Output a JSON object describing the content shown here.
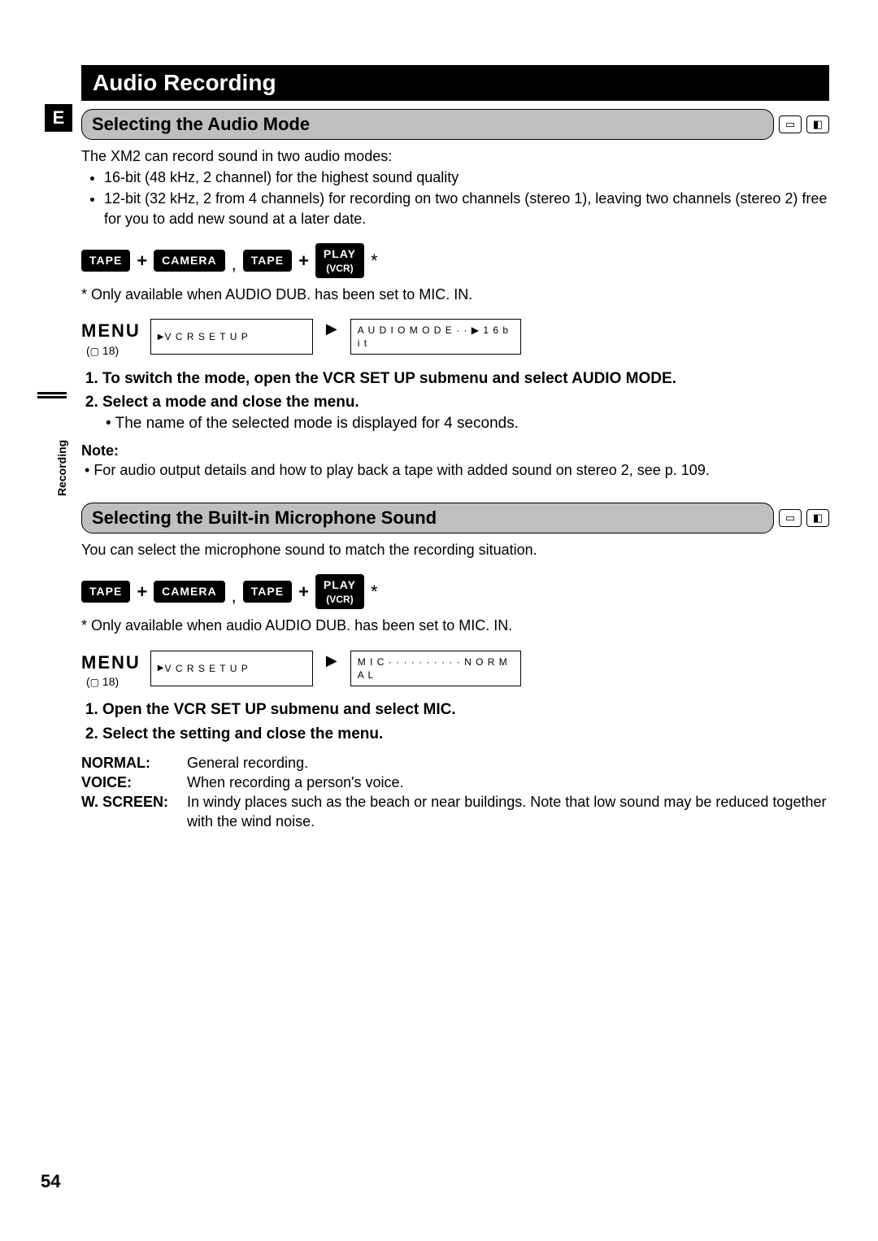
{
  "language_badge": "E",
  "side_tab": "Recording",
  "page_number": "54",
  "title": "Audio Recording",
  "section1": {
    "heading": "Selecting the Audio Mode",
    "intro": "The XM2 can record sound in two audio modes:",
    "bullets": [
      "16-bit (48 kHz, 2 channel) for the highest sound quality",
      "12-bit (32 kHz, 2 from 4 channels) for recording on two channels (stereo 1), leaving two channels (stereo 2) free for you to add new sound at a later date."
    ],
    "footnote": "* Only available when AUDIO DUB. has been set to MIC. IN.",
    "menu_label": "MENU",
    "menu_ref": "18",
    "osd1_label": "V C R   S E T   U P",
    "osd2_label": "A U D I O   M O D E · · ▶ 1 6 b i t",
    "steps": [
      "To switch the mode, open the VCR SET UP submenu and select AUDIO MODE.",
      "Select a mode and close the menu."
    ],
    "step_detail": "The name of the selected mode is displayed for 4 seconds.",
    "note_heading": "Note:",
    "note_body": "For audio output details and how to play back a tape with added sound on stereo 2, see p. 109."
  },
  "buttons": {
    "tape": "TAPE",
    "camera": "CAMERA",
    "play_l1": "PLAY",
    "play_l2": "(VCR)"
  },
  "section2": {
    "heading": "Selecting the Built-in Microphone Sound",
    "intro": "You can select the microphone sound to match the recording situation.",
    "footnote": "* Only available when audio AUDIO DUB. has been set to MIC. IN.",
    "menu_label": "MENU",
    "menu_ref": "18",
    "osd1_label": "V C R   S E T   U P",
    "osd2_label": "M I C · · · · · · · · · · N O R M A L",
    "steps": [
      "Open the VCR SET UP submenu and select MIC.",
      "Select the setting and close the menu."
    ],
    "settings": [
      {
        "term": "NORMAL:",
        "def": "General recording."
      },
      {
        "term": "VOICE:",
        "def": "When recording a person's voice."
      },
      {
        "term": "W. SCREEN:",
        "def": "In windy places such as the beach or near buildings. Note that low sound may be reduced together with the wind noise."
      }
    ]
  }
}
